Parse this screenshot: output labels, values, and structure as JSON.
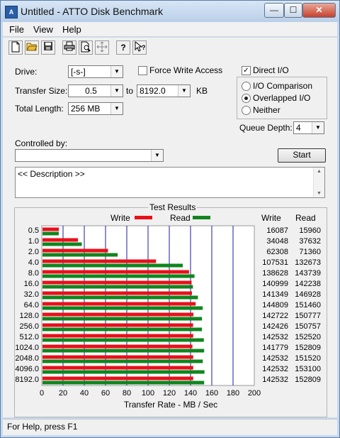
{
  "window": {
    "title": "Untitled - ATTO Disk Benchmark",
    "controls": {
      "minimize": "—",
      "maximize": "☐",
      "close": "✕"
    }
  },
  "menu": {
    "file": "File",
    "view": "View",
    "help": "Help"
  },
  "toolbar_icons": [
    "new-icon",
    "open-icon",
    "save-icon",
    "print-icon",
    "print-preview-icon",
    "move-icon",
    "help-icon",
    "context-help-icon"
  ],
  "form": {
    "drive_label": "Drive:",
    "drive_value": "[-s-]",
    "transfer_size_label": "Transfer Size:",
    "transfer_size_from": "0.5",
    "to_label": "to",
    "transfer_size_to": "8192.0",
    "kb_label": "KB",
    "total_length_label": "Total Length:",
    "total_length_value": "256 MB",
    "force_write_access_label": "Force Write Access",
    "force_write_access_checked": false,
    "direct_io_label": "Direct I/O",
    "direct_io_checked": true,
    "io_comparison_label": "I/O Comparison",
    "overlapped_io_label": "Overlapped I/O",
    "neither_label": "Neither",
    "selected_io_mode": "Overlapped I/O",
    "queue_depth_label": "Queue Depth:",
    "queue_depth_value": "4",
    "controlled_by_label": "Controlled by:",
    "controlled_by_value": "",
    "start_label": "Start",
    "description_text": "<< Description >>"
  },
  "results": {
    "group_label": "Test Results",
    "write_legend": "Write",
    "read_legend": "Read",
    "write_col_header": "Write",
    "read_col_header": "Read",
    "write_color": "#e8101a",
    "read_color": "#10851e"
  },
  "chart_data": {
    "type": "bar",
    "orientation": "horizontal",
    "categories": [
      "0.5",
      "1.0",
      "2.0",
      "4.0",
      "8.0",
      "16.0",
      "32.0",
      "64.0",
      "128.0",
      "256.0",
      "512.0",
      "1024.0",
      "2048.0",
      "4096.0",
      "8192.0"
    ],
    "series": [
      {
        "name": "Write",
        "color": "#e8101a",
        "values": [
          16087,
          34048,
          62308,
          107531,
          138628,
          140999,
          141349,
          144809,
          142722,
          142426,
          142532,
          141779,
          142532,
          142532,
          142532
        ]
      },
      {
        "name": "Read",
        "color": "#10851e",
        "values": [
          15960,
          37632,
          71360,
          132673,
          143739,
          142238,
          146928,
          151460,
          150777,
          150757,
          152520,
          152809,
          151520,
          153100,
          152809
        ]
      }
    ],
    "xlabel": "Transfer Rate - MB / Sec",
    "xlim": [
      0,
      200
    ],
    "xticks": [
      "0",
      "20",
      "40",
      "60",
      "80",
      "100",
      "120",
      "140",
      "160",
      "180",
      "200"
    ],
    "value_unit_divisor": 1000
  },
  "status": {
    "text": "For Help, press F1"
  }
}
